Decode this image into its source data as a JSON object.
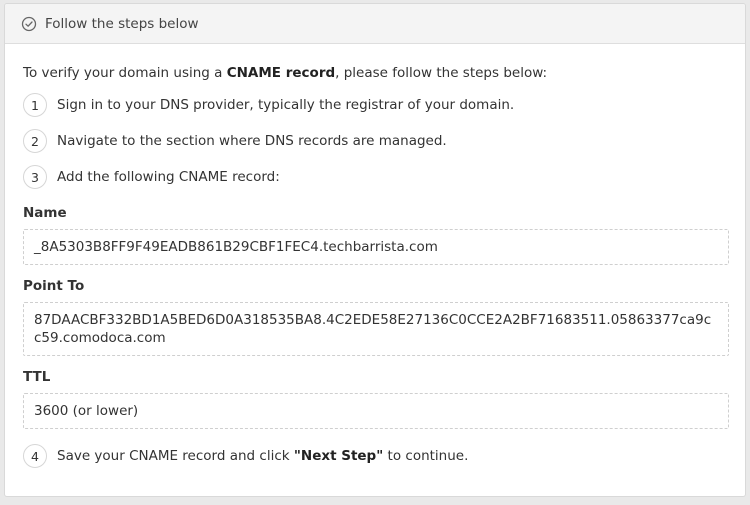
{
  "header": {
    "title": "Follow the steps below",
    "icon": "check-circle-icon"
  },
  "intro": {
    "prefix": "To verify your domain using a ",
    "bold": "CNAME record",
    "suffix": ", please follow the steps below:"
  },
  "steps": [
    {
      "number": "1",
      "text": "Sign in to your DNS provider, typically the registrar of your domain."
    },
    {
      "number": "2",
      "text": "Navigate to the section where DNS records are managed."
    },
    {
      "number": "3",
      "text": "Add the following CNAME record:"
    },
    {
      "number": "4",
      "prefix": "Save your CNAME record and click ",
      "bold": "\"Next Step\"",
      "suffix": " to continue."
    }
  ],
  "record": {
    "name_label": "Name",
    "name_value": "_8A5303B8FF9F49EADB861B29CBF1FEC4.techbarrista.com",
    "point_to_label": "Point To",
    "point_to_value": "87DAACBF332BD1A5BED6D0A318535BA8.4C2EDE58E27136C0CCE2A2BF71683511.05863377ca9cc59.comodoca.com",
    "ttl_label": "TTL",
    "ttl_value": "3600 (or lower)"
  }
}
